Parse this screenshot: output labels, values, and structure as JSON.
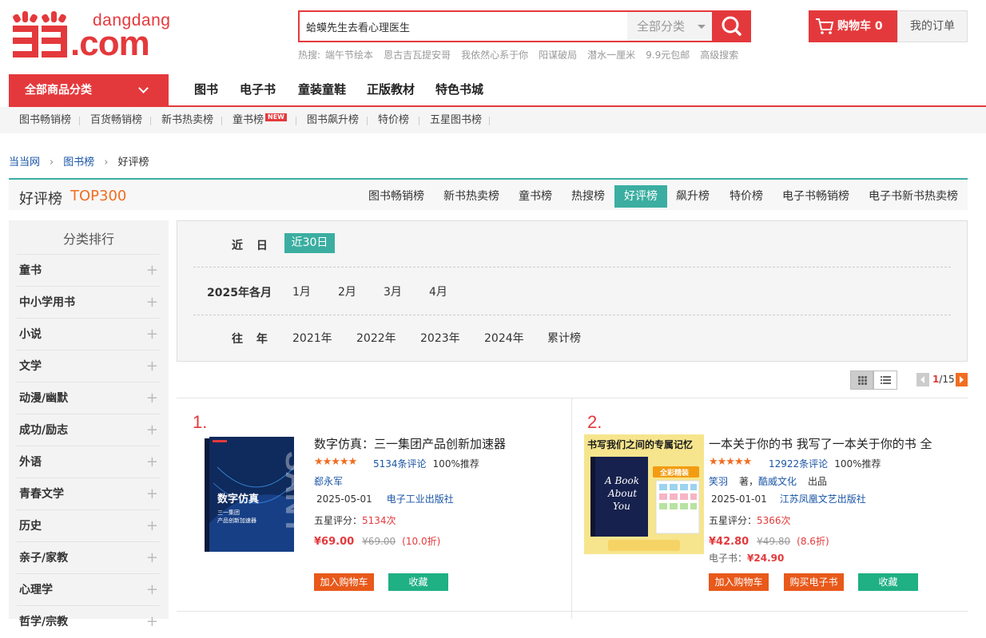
{
  "logo": {
    "text_top": "dangdang",
    "text_main": ".com"
  },
  "search": {
    "value": "蛤蟆先生去看心理医生",
    "category": "全部分类"
  },
  "hot": {
    "label": "热搜:",
    "items": [
      "端午节绘本",
      "恩古吉瓦提安哥",
      "我依然心系于你",
      "阳谋破局",
      "潜水一厘米",
      "9.9元包邮",
      "高级搜索"
    ]
  },
  "cart": {
    "label": "购物车 0"
  },
  "orders": {
    "label": "我的订单"
  },
  "nav": {
    "category": "全部商品分类",
    "items": [
      "图书",
      "电子书",
      "童装童鞋",
      "正版教材",
      "特色书城"
    ]
  },
  "subnav": {
    "items": [
      "图书畅销榜",
      "百货畅销榜",
      "新书热卖榜",
      "童书榜",
      "图书飙升榜",
      "特价榜",
      "五星图书榜"
    ],
    "badge": "NEW"
  },
  "breadcrumb": {
    "items": [
      "当当网",
      "图书榜",
      "好评榜"
    ]
  },
  "rank_title": {
    "main": "好评榜",
    "top": "TOP300"
  },
  "rank_tabs": [
    {
      "label": "图书畅销榜"
    },
    {
      "label": "新书热卖榜"
    },
    {
      "label": "童书榜"
    },
    {
      "label": "热搜榜"
    },
    {
      "label": "好评榜"
    },
    {
      "label": "飙升榜"
    },
    {
      "label": "特价榜"
    },
    {
      "label": "电子书畅销榜"
    },
    {
      "label": "电子书新书热卖榜"
    }
  ],
  "sidebar": {
    "title": "分类排行",
    "items": [
      "童书",
      "中小学用书",
      "小说",
      "文学",
      "动漫/幽默",
      "成功/励志",
      "外语",
      "青春文学",
      "历史",
      "亲子/家教",
      "心理学",
      "哲学/宗教"
    ]
  },
  "filter": {
    "recent_label": "近  日",
    "recent_option": "近30日",
    "month_label": "2025年各月",
    "months": [
      "1月",
      "2月",
      "3月",
      "4月"
    ],
    "year_label": "往  年",
    "years": [
      "2021年",
      "2022年",
      "2023年",
      "2024年",
      "累计榜"
    ]
  },
  "pagination": {
    "current": "1",
    "total": "/15"
  },
  "products": [
    {
      "rank": "1.",
      "title": "数字仿真：三一集团产品创新加速器",
      "stars": "★★★★★",
      "reviews": "5134条评论",
      "recommend": "100%推荐",
      "author": "郄永军",
      "date": "2025-05-01",
      "publisher": "电子工业出版社",
      "five_star_label": "五星评分：",
      "five_star": "5134次",
      "price": "¥69.00",
      "old_price": "¥69.00",
      "discount": "(10.0折)",
      "cover_title": "数字仿真",
      "cover_sub1": "三一集团",
      "cover_sub2": "产品创新加速器",
      "cover_brand": "SANY",
      "btn_cart": "加入购物车",
      "btn_fav": "收藏"
    },
    {
      "rank": "2.",
      "title": "一本关于你的书 我写了一本关于你的书 全",
      "stars": "★★★★★",
      "reviews": "12922条评论",
      "recommend": "100%推荐",
      "author": "笑羽",
      "author_role": "著，",
      "author2": "酷威文化",
      "producer": "出品",
      "date": "2025-01-01",
      "publisher": "江苏凤凰文艺出版社",
      "five_star_label": "五星评分：",
      "five_star": "5366次",
      "price": "¥42.80",
      "old_price": "¥49.80",
      "discount": "(8.6折)",
      "ebook_label": "电子书：",
      "ebook_price": "¥24.90",
      "cover_header": "书写我们之间的专属记忆",
      "cover_tag": "全彩精装",
      "cover_title1": "A Book",
      "cover_title2": "About",
      "cover_title3": "You",
      "btn_cart": "加入购物车",
      "btn_ebook": "购买电子书",
      "btn_fav": "收藏"
    }
  ]
}
